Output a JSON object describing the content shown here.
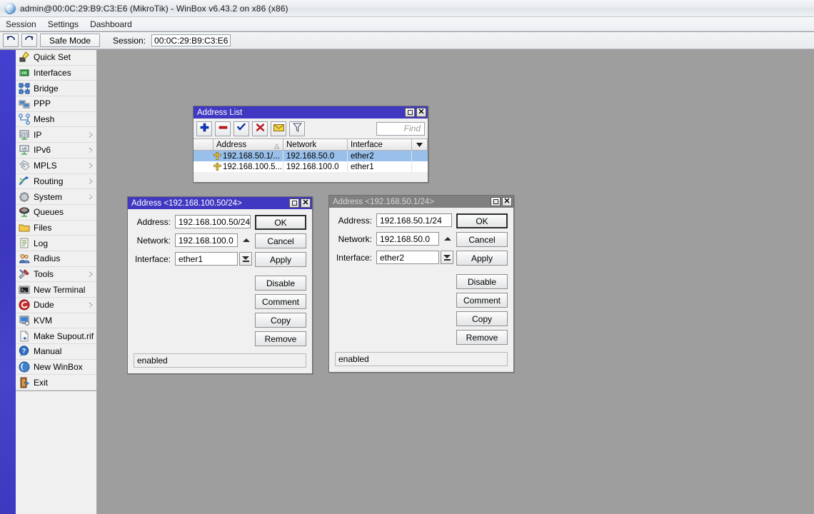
{
  "window": {
    "title": "admin@00:0C:29:B9:C3:E6 (MikroTik) - WinBox v6.43.2 on x86 (x86)",
    "logo_icon": "winbox-logo-icon"
  },
  "menubar": {
    "items": [
      {
        "label": "Session"
      },
      {
        "label": "Settings"
      },
      {
        "label": "Dashboard"
      }
    ]
  },
  "toolbar": {
    "undo_icon": "undo-icon",
    "redo_icon": "redo-icon",
    "safe_mode_label": "Safe Mode",
    "session_label": "Session:",
    "session_value": "00:0C:29:B9:C3:E6"
  },
  "sidebar": {
    "items": [
      {
        "label": "Quick Set",
        "icon": "quick-set-icon",
        "submenu": false
      },
      {
        "label": "Interfaces",
        "icon": "interfaces-icon",
        "submenu": false
      },
      {
        "label": "Bridge",
        "icon": "bridge-icon",
        "submenu": false
      },
      {
        "label": "PPP",
        "icon": "ppp-icon",
        "submenu": false
      },
      {
        "label": "Mesh",
        "icon": "mesh-icon",
        "submenu": false
      },
      {
        "label": "IP",
        "icon": "ip-icon",
        "submenu": true
      },
      {
        "label": "IPv6",
        "icon": "ipv6-icon",
        "submenu": true
      },
      {
        "label": "MPLS",
        "icon": "mpls-icon",
        "submenu": true
      },
      {
        "label": "Routing",
        "icon": "routing-icon",
        "submenu": true
      },
      {
        "label": "System",
        "icon": "system-gear-icon",
        "submenu": true
      },
      {
        "label": "Queues",
        "icon": "queues-icon",
        "submenu": false
      },
      {
        "label": "Files",
        "icon": "files-folder-icon",
        "submenu": false
      },
      {
        "label": "Log",
        "icon": "log-icon",
        "submenu": false
      },
      {
        "label": "Radius",
        "icon": "radius-users-icon",
        "submenu": false
      },
      {
        "label": "Tools",
        "icon": "tools-icon",
        "submenu": true
      },
      {
        "label": "New Terminal",
        "icon": "terminal-icon",
        "submenu": false
      },
      {
        "label": "Dude",
        "icon": "dude-icon",
        "submenu": true
      },
      {
        "label": "KVM",
        "icon": "kvm-icon",
        "submenu": false
      },
      {
        "label": "Make Supout.rif",
        "icon": "supout-file-icon",
        "submenu": false
      },
      {
        "label": "Manual",
        "icon": "manual-help-icon",
        "submenu": false
      },
      {
        "label": "New WinBox",
        "icon": "new-winbox-icon",
        "submenu": false
      },
      {
        "label": "Exit",
        "icon": "exit-door-icon",
        "submenu": false
      }
    ]
  },
  "address_list": {
    "title": "Address List",
    "maximize_icon": "maximize-icon",
    "close_icon": "close-icon",
    "toolbar": [
      {
        "name": "add-button",
        "icon": "plus-icon"
      },
      {
        "name": "remove-button",
        "icon": "minus-icon"
      },
      {
        "name": "enable-button",
        "icon": "check-icon"
      },
      {
        "name": "disable-button",
        "icon": "cross-icon"
      },
      {
        "name": "comment-button",
        "icon": "comment-icon"
      },
      {
        "name": "filter-button",
        "icon": "funnel-icon"
      }
    ],
    "find_placeholder": "Find",
    "columns": [
      "Address",
      "Network",
      "Interface"
    ],
    "sort_indicator": "△",
    "dropdown_icon": "chevron-down-icon",
    "rows": [
      {
        "address": "192.168.50.1/...",
        "network": "192.168.50.0",
        "interface": "ether2",
        "selected": true,
        "icon": "address-pin-icon"
      },
      {
        "address": "192.168.100.5...",
        "network": "192.168.100.0",
        "interface": "ether1",
        "selected": false,
        "icon": "address-pin-icon"
      }
    ]
  },
  "dialog_one": {
    "title": "Address <192.168.100.50/24>",
    "active": true,
    "maximize_icon": "maximize-icon",
    "close_icon": "close-icon",
    "fields": {
      "address_label": "Address:",
      "address_value": "192.168.100.50/24",
      "network_label": "Network:",
      "network_value": "192.168.100.0",
      "interface_label": "Interface:",
      "interface_value": "ether1"
    },
    "buttons": [
      "OK",
      "Cancel",
      "Apply",
      "Disable",
      "Comment",
      "Copy",
      "Remove"
    ],
    "status": "enabled"
  },
  "dialog_two": {
    "title": "Address <192.168.50.1/24>",
    "active": false,
    "maximize_icon": "maximize-icon",
    "close_icon": "close-icon",
    "fields": {
      "address_label": "Address:",
      "address_value": "192.168.50.1/24",
      "network_label": "Network:",
      "network_value": "192.168.50.0",
      "interface_label": "Interface:",
      "interface_value": "ether2"
    },
    "buttons": [
      "OK",
      "Cancel",
      "Apply",
      "Disable",
      "Comment",
      "Copy",
      "Remove"
    ],
    "status": "enabled"
  },
  "colors": {
    "desktop": "#9e9e9e",
    "rail_blue": "#4038c0",
    "active_title": "#4038c0",
    "inactive_title": "#808080",
    "selection": "#99c0ea",
    "chrome": "#f0f0f0"
  }
}
